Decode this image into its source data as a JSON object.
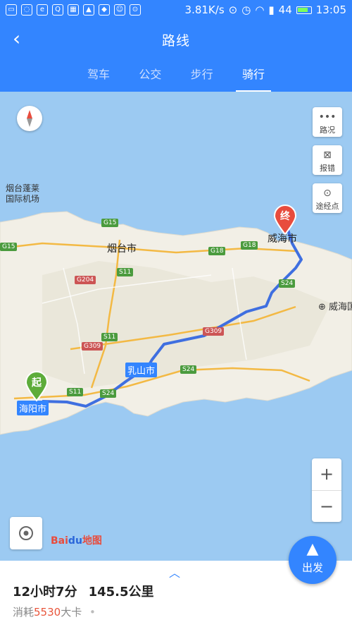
{
  "status_bar": {
    "speed": "3.81K/s",
    "signal": "44",
    "time": "13:05"
  },
  "header": {
    "back_icon": "back-arrow-icon",
    "title": "路线"
  },
  "tabs": [
    {
      "label": "驾车",
      "active": false
    },
    {
      "label": "公交",
      "active": false
    },
    {
      "label": "步行",
      "active": false
    },
    {
      "label": "骑行",
      "active": true
    }
  ],
  "map": {
    "side_buttons": [
      {
        "label": "路况",
        "icon": "traffic-icon"
      },
      {
        "label": "报错",
        "icon": "report-icon"
      },
      {
        "label": "途经点",
        "icon": "waypoint-icon"
      }
    ],
    "zoom_in": "+",
    "zoom_out": "−",
    "labels": {
      "airport": "烟台蓬莱\n国际机场",
      "yantai": "烟台市",
      "weihai": "威海市",
      "weihai_east": "威海国",
      "rushan": "乳山市",
      "haiyang": "海阳市"
    },
    "roads": [
      "G15",
      "G15",
      "G18",
      "G18",
      "G204",
      "S11",
      "S11",
      "S11",
      "S24",
      "S24",
      "S24",
      "G309",
      "G309"
    ],
    "start_marker": "起",
    "end_marker": "终",
    "logo_bai": "Bai",
    "logo_du": "du",
    "logo_map": "地图"
  },
  "depart_button": {
    "label": "出发"
  },
  "summary": {
    "time": "12小时7分",
    "distance": "145.5公里",
    "cal_prefix": "消耗",
    "cal_value": "5530",
    "cal_suffix": "大卡",
    "dot": "•"
  },
  "colors": {
    "primary": "#3385ff",
    "route": "#3f6fe0",
    "calorie": "#e8553b"
  }
}
